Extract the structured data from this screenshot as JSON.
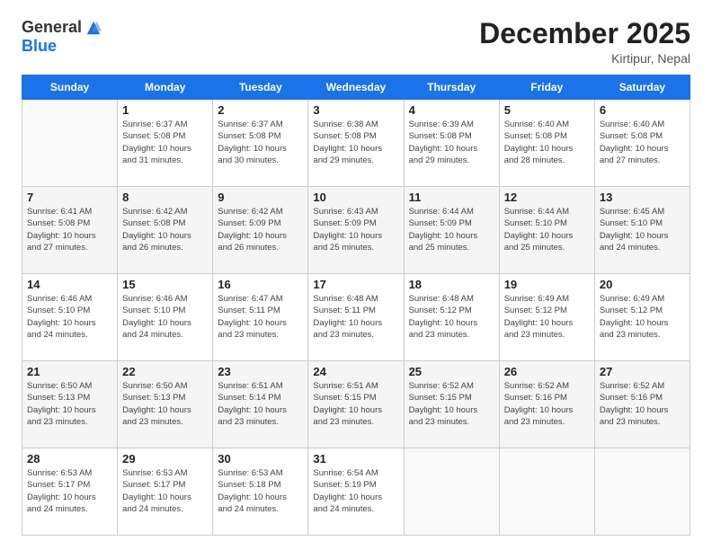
{
  "header": {
    "logo_general": "General",
    "logo_blue": "Blue",
    "month_title": "December 2025",
    "location": "Kirtipur, Nepal"
  },
  "days_of_week": [
    "Sunday",
    "Monday",
    "Tuesday",
    "Wednesday",
    "Thursday",
    "Friday",
    "Saturday"
  ],
  "weeks": [
    [
      {
        "day": "",
        "info": ""
      },
      {
        "day": "1",
        "info": "Sunrise: 6:37 AM\nSunset: 5:08 PM\nDaylight: 10 hours\nand 31 minutes."
      },
      {
        "day": "2",
        "info": "Sunrise: 6:37 AM\nSunset: 5:08 PM\nDaylight: 10 hours\nand 30 minutes."
      },
      {
        "day": "3",
        "info": "Sunrise: 6:38 AM\nSunset: 5:08 PM\nDaylight: 10 hours\nand 29 minutes."
      },
      {
        "day": "4",
        "info": "Sunrise: 6:39 AM\nSunset: 5:08 PM\nDaylight: 10 hours\nand 29 minutes."
      },
      {
        "day": "5",
        "info": "Sunrise: 6:40 AM\nSunset: 5:08 PM\nDaylight: 10 hours\nand 28 minutes."
      },
      {
        "day": "6",
        "info": "Sunrise: 6:40 AM\nSunset: 5:08 PM\nDaylight: 10 hours\nand 27 minutes."
      }
    ],
    [
      {
        "day": "7",
        "info": "Sunrise: 6:41 AM\nSunset: 5:08 PM\nDaylight: 10 hours\nand 27 minutes."
      },
      {
        "day": "8",
        "info": "Sunrise: 6:42 AM\nSunset: 5:08 PM\nDaylight: 10 hours\nand 26 minutes."
      },
      {
        "day": "9",
        "info": "Sunrise: 6:42 AM\nSunset: 5:09 PM\nDaylight: 10 hours\nand 26 minutes."
      },
      {
        "day": "10",
        "info": "Sunrise: 6:43 AM\nSunset: 5:09 PM\nDaylight: 10 hours\nand 25 minutes."
      },
      {
        "day": "11",
        "info": "Sunrise: 6:44 AM\nSunset: 5:09 PM\nDaylight: 10 hours\nand 25 minutes."
      },
      {
        "day": "12",
        "info": "Sunrise: 6:44 AM\nSunset: 5:10 PM\nDaylight: 10 hours\nand 25 minutes."
      },
      {
        "day": "13",
        "info": "Sunrise: 6:45 AM\nSunset: 5:10 PM\nDaylight: 10 hours\nand 24 minutes."
      }
    ],
    [
      {
        "day": "14",
        "info": "Sunrise: 6:46 AM\nSunset: 5:10 PM\nDaylight: 10 hours\nand 24 minutes."
      },
      {
        "day": "15",
        "info": "Sunrise: 6:46 AM\nSunset: 5:10 PM\nDaylight: 10 hours\nand 24 minutes."
      },
      {
        "day": "16",
        "info": "Sunrise: 6:47 AM\nSunset: 5:11 PM\nDaylight: 10 hours\nand 23 minutes."
      },
      {
        "day": "17",
        "info": "Sunrise: 6:48 AM\nSunset: 5:11 PM\nDaylight: 10 hours\nand 23 minutes."
      },
      {
        "day": "18",
        "info": "Sunrise: 6:48 AM\nSunset: 5:12 PM\nDaylight: 10 hours\nand 23 minutes."
      },
      {
        "day": "19",
        "info": "Sunrise: 6:49 AM\nSunset: 5:12 PM\nDaylight: 10 hours\nand 23 minutes."
      },
      {
        "day": "20",
        "info": "Sunrise: 6:49 AM\nSunset: 5:12 PM\nDaylight: 10 hours\nand 23 minutes."
      }
    ],
    [
      {
        "day": "21",
        "info": "Sunrise: 6:50 AM\nSunset: 5:13 PM\nDaylight: 10 hours\nand 23 minutes."
      },
      {
        "day": "22",
        "info": "Sunrise: 6:50 AM\nSunset: 5:13 PM\nDaylight: 10 hours\nand 23 minutes."
      },
      {
        "day": "23",
        "info": "Sunrise: 6:51 AM\nSunset: 5:14 PM\nDaylight: 10 hours\nand 23 minutes."
      },
      {
        "day": "24",
        "info": "Sunrise: 6:51 AM\nSunset: 5:15 PM\nDaylight: 10 hours\nand 23 minutes."
      },
      {
        "day": "25",
        "info": "Sunrise: 6:52 AM\nSunset: 5:15 PM\nDaylight: 10 hours\nand 23 minutes."
      },
      {
        "day": "26",
        "info": "Sunrise: 6:52 AM\nSunset: 5:16 PM\nDaylight: 10 hours\nand 23 minutes."
      },
      {
        "day": "27",
        "info": "Sunrise: 6:52 AM\nSunset: 5:16 PM\nDaylight: 10 hours\nand 23 minutes."
      }
    ],
    [
      {
        "day": "28",
        "info": "Sunrise: 6:53 AM\nSunset: 5:17 PM\nDaylight: 10 hours\nand 24 minutes."
      },
      {
        "day": "29",
        "info": "Sunrise: 6:53 AM\nSunset: 5:17 PM\nDaylight: 10 hours\nand 24 minutes."
      },
      {
        "day": "30",
        "info": "Sunrise: 6:53 AM\nSunset: 5:18 PM\nDaylight: 10 hours\nand 24 minutes."
      },
      {
        "day": "31",
        "info": "Sunrise: 6:54 AM\nSunset: 5:19 PM\nDaylight: 10 hours\nand 24 minutes."
      },
      {
        "day": "",
        "info": ""
      },
      {
        "day": "",
        "info": ""
      },
      {
        "day": "",
        "info": ""
      }
    ]
  ]
}
